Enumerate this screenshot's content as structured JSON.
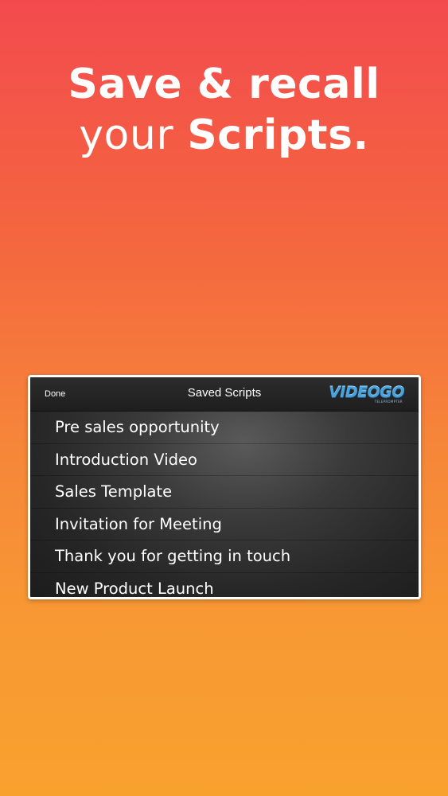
{
  "headline": {
    "line1": "Save & recall",
    "line2_light": "your ",
    "line2_bold": "Scripts."
  },
  "panel": {
    "done_label": "Done",
    "title": "Saved Scripts",
    "logo_text": "VIDEOGO",
    "logo_sub": "TELEPROMPTER",
    "scripts": [
      "Pre sales opportunity",
      "Introduction Video",
      "Sales Template",
      "Invitation for Meeting",
      "Thank you for getting in touch",
      "New Product Launch"
    ]
  },
  "colors": {
    "gradient_top": "#f34a4e",
    "gradient_bottom": "#f9a12f",
    "logo_blue": "#4aa3dc"
  }
}
